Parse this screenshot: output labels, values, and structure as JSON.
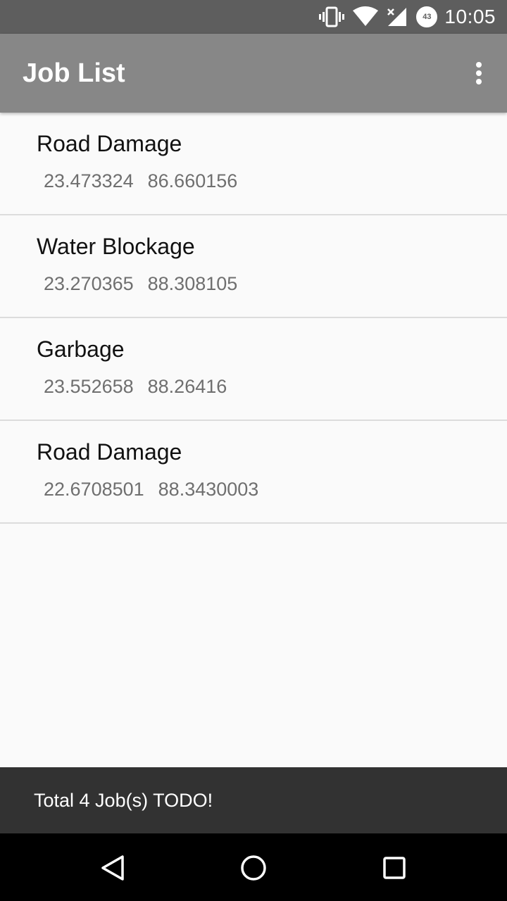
{
  "status_bar": {
    "time": "10:05",
    "battery_level": "43",
    "icons": [
      "vibrate-icon",
      "wifi-icon",
      "signal-icon",
      "battery-icon"
    ]
  },
  "app_bar": {
    "title": "Job List",
    "menu_icon": "overflow-menu-icon"
  },
  "jobs": [
    {
      "title": "Road Damage",
      "lat": "23.473324",
      "lng": "86.660156"
    },
    {
      "title": "Water Blockage",
      "lat": "23.270365",
      "lng": "88.308105"
    },
    {
      "title": "Garbage",
      "lat": "23.552658",
      "lng": "88.26416"
    },
    {
      "title": "Road Damage",
      "lat": "22.6708501",
      "lng": "88.3430003"
    }
  ],
  "footer": {
    "summary": "Total 4 Job(s) TODO!"
  },
  "nav_bar": {
    "icons": [
      "back-icon",
      "home-icon",
      "recents-icon"
    ]
  },
  "colors": {
    "status_bar": "#5e5e5e",
    "app_bar": "#878787",
    "background": "#fafafa",
    "footer": "#323232",
    "nav_bar": "#000000"
  }
}
